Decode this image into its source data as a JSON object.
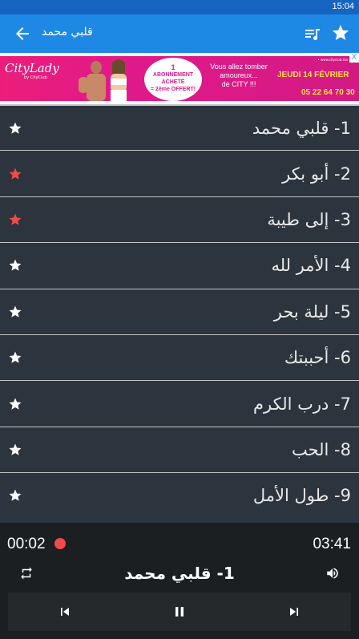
{
  "status_bar": {
    "time": "15:04"
  },
  "app_bar": {
    "title": "قلبي محمد",
    "icons": {
      "back": "arrow-back-icon",
      "playlist": "playlist-music-icon",
      "favorite": "star-icon"
    }
  },
  "ad": {
    "brand": "CityLady",
    "brand_sub": "by CityClub",
    "badge": [
      "1",
      "ABONNEMENT",
      "ACHETÉ",
      "= 2ème OFFERT!"
    ],
    "promo": [
      "Vous allez tomber",
      "amoureux...",
      "de CITY !!!"
    ],
    "date": "JEUDI 14 FÉVRIER",
    "phone": "05 22 64 70 30",
    "site": "• www.cityclub.ma",
    "close": "X"
  },
  "tracks": [
    {
      "label": "1- قلبي محمد",
      "favorite": false
    },
    {
      "label": "2- أبو بكر",
      "favorite": true
    },
    {
      "label": "3- إلى طيبة",
      "favorite": true
    },
    {
      "label": "4- الأمر لله",
      "favorite": false
    },
    {
      "label": "5- ليلة بحر",
      "favorite": false
    },
    {
      "label": "6- أحببتك",
      "favorite": false
    },
    {
      "label": "7- درب الكرم",
      "favorite": false
    },
    {
      "label": "8- الحب",
      "favorite": false
    },
    {
      "label": "9- طول الأمل",
      "favorite": false
    }
  ],
  "player": {
    "current_time": "00:02",
    "total_time": "03:41",
    "now_playing": "1- قلبي محمد",
    "state": "playing"
  },
  "colors": {
    "appbar": "#1e88e5",
    "statusbar": "#1564c0",
    "list_bg": "#2c353d",
    "favorite_star": "#f04a4a",
    "normal_star": "#ffffff",
    "player_bg": "#1c1f22",
    "record_dot": "#f04a4a"
  }
}
